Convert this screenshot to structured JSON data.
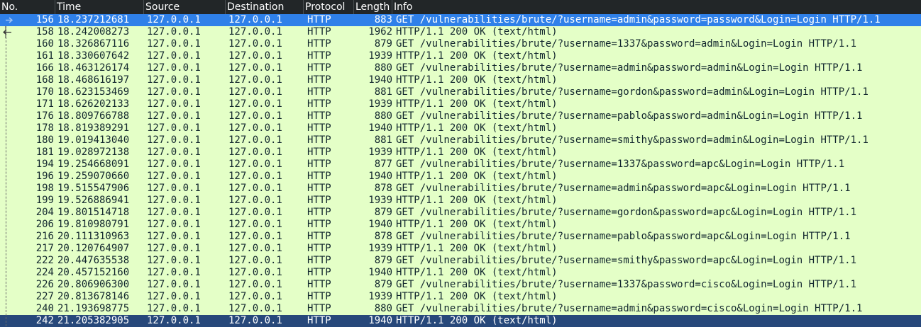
{
  "columns": {
    "no": "No.",
    "time": "Time",
    "source": "Source",
    "destination": "Destination",
    "protocol": "Protocol",
    "length": "Length",
    "info": "Info"
  },
  "colors": {
    "row_bg": "#e4ffc7",
    "header_bg": "#222628",
    "selected_row": "#2f80e9",
    "focused_row": "#27487a",
    "text": "#12272e"
  },
  "icons": {
    "request": "request-arrow-icon",
    "response": "response-arrow-icon"
  },
  "packets": [
    {
      "no": "156",
      "time": "18.237212681",
      "src": "127.0.0.1",
      "dst": "127.0.0.1",
      "proto": "HTTP",
      "len": "883",
      "info": "GET /vulnerabilities/brute/?username=admin&password=password&Login=Login HTTP/1.1"
    },
    {
      "no": "158",
      "time": "18.242008273",
      "src": "127.0.0.1",
      "dst": "127.0.0.1",
      "proto": "HTTP",
      "len": "1962",
      "info": "HTTP/1.1 200 OK  (text/html)"
    },
    {
      "no": "160",
      "time": "18.326867116",
      "src": "127.0.0.1",
      "dst": "127.0.0.1",
      "proto": "HTTP",
      "len": "879",
      "info": "GET /vulnerabilities/brute/?username=1337&password=admin&Login=Login HTTP/1.1"
    },
    {
      "no": "161",
      "time": "18.330607642",
      "src": "127.0.0.1",
      "dst": "127.0.0.1",
      "proto": "HTTP",
      "len": "1939",
      "info": "HTTP/1.1 200 OK  (text/html)"
    },
    {
      "no": "166",
      "time": "18.463126174",
      "src": "127.0.0.1",
      "dst": "127.0.0.1",
      "proto": "HTTP",
      "len": "880",
      "info": "GET /vulnerabilities/brute/?username=admin&password=admin&Login=Login HTTP/1.1"
    },
    {
      "no": "168",
      "time": "18.468616197",
      "src": "127.0.0.1",
      "dst": "127.0.0.1",
      "proto": "HTTP",
      "len": "1940",
      "info": "HTTP/1.1 200 OK  (text/html)"
    },
    {
      "no": "170",
      "time": "18.623153469",
      "src": "127.0.0.1",
      "dst": "127.0.0.1",
      "proto": "HTTP",
      "len": "881",
      "info": "GET /vulnerabilities/brute/?username=gordon&password=admin&Login=Login HTTP/1.1"
    },
    {
      "no": "171",
      "time": "18.626202133",
      "src": "127.0.0.1",
      "dst": "127.0.0.1",
      "proto": "HTTP",
      "len": "1939",
      "info": "HTTP/1.1 200 OK  (text/html)"
    },
    {
      "no": "176",
      "time": "18.809766788",
      "src": "127.0.0.1",
      "dst": "127.0.0.1",
      "proto": "HTTP",
      "len": "880",
      "info": "GET /vulnerabilities/brute/?username=pablo&password=admin&Login=Login HTTP/1.1"
    },
    {
      "no": "178",
      "time": "18.819389291",
      "src": "127.0.0.1",
      "dst": "127.0.0.1",
      "proto": "HTTP",
      "len": "1940",
      "info": "HTTP/1.1 200 OK  (text/html)"
    },
    {
      "no": "180",
      "time": "19.019413040",
      "src": "127.0.0.1",
      "dst": "127.0.0.1",
      "proto": "HTTP",
      "len": "881",
      "info": "GET /vulnerabilities/brute/?username=smithy&password=admin&Login=Login HTTP/1.1"
    },
    {
      "no": "181",
      "time": "19.028972138",
      "src": "127.0.0.1",
      "dst": "127.0.0.1",
      "proto": "HTTP",
      "len": "1939",
      "info": "HTTP/1.1 200 OK  (text/html)"
    },
    {
      "no": "194",
      "time": "19.254668091",
      "src": "127.0.0.1",
      "dst": "127.0.0.1",
      "proto": "HTTP",
      "len": "877",
      "info": "GET /vulnerabilities/brute/?username=1337&password=apc&Login=Login HTTP/1.1"
    },
    {
      "no": "196",
      "time": "19.259070660",
      "src": "127.0.0.1",
      "dst": "127.0.0.1",
      "proto": "HTTP",
      "len": "1940",
      "info": "HTTP/1.1 200 OK  (text/html)"
    },
    {
      "no": "198",
      "time": "19.515547906",
      "src": "127.0.0.1",
      "dst": "127.0.0.1",
      "proto": "HTTP",
      "len": "878",
      "info": "GET /vulnerabilities/brute/?username=admin&password=apc&Login=Login HTTP/1.1"
    },
    {
      "no": "199",
      "time": "19.526886941",
      "src": "127.0.0.1",
      "dst": "127.0.0.1",
      "proto": "HTTP",
      "len": "1939",
      "info": "HTTP/1.1 200 OK  (text/html)"
    },
    {
      "no": "204",
      "time": "19.801514718",
      "src": "127.0.0.1",
      "dst": "127.0.0.1",
      "proto": "HTTP",
      "len": "879",
      "info": "GET /vulnerabilities/brute/?username=gordon&password=apc&Login=Login HTTP/1.1"
    },
    {
      "no": "206",
      "time": "19.810980791",
      "src": "127.0.0.1",
      "dst": "127.0.0.1",
      "proto": "HTTP",
      "len": "1940",
      "info": "HTTP/1.1 200 OK  (text/html)"
    },
    {
      "no": "216",
      "time": "20.111310963",
      "src": "127.0.0.1",
      "dst": "127.0.0.1",
      "proto": "HTTP",
      "len": "878",
      "info": "GET /vulnerabilities/brute/?username=pablo&password=apc&Login=Login HTTP/1.1"
    },
    {
      "no": "217",
      "time": "20.120764907",
      "src": "127.0.0.1",
      "dst": "127.0.0.1",
      "proto": "HTTP",
      "len": "1939",
      "info": "HTTP/1.1 200 OK  (text/html)"
    },
    {
      "no": "222",
      "time": "20.447635538",
      "src": "127.0.0.1",
      "dst": "127.0.0.1",
      "proto": "HTTP",
      "len": "879",
      "info": "GET /vulnerabilities/brute/?username=smithy&password=apc&Login=Login HTTP/1.1"
    },
    {
      "no": "224",
      "time": "20.457152160",
      "src": "127.0.0.1",
      "dst": "127.0.0.1",
      "proto": "HTTP",
      "len": "1940",
      "info": "HTTP/1.1 200 OK  (text/html)"
    },
    {
      "no": "226",
      "time": "20.806906300",
      "src": "127.0.0.1",
      "dst": "127.0.0.1",
      "proto": "HTTP",
      "len": "879",
      "info": "GET /vulnerabilities/brute/?username=1337&password=cisco&Login=Login HTTP/1.1"
    },
    {
      "no": "227",
      "time": "20.813678146",
      "src": "127.0.0.1",
      "dst": "127.0.0.1",
      "proto": "HTTP",
      "len": "1939",
      "info": "HTTP/1.1 200 OK  (text/html)"
    },
    {
      "no": "240",
      "time": "21.193698775",
      "src": "127.0.0.1",
      "dst": "127.0.0.1",
      "proto": "HTTP",
      "len": "880",
      "info": "GET /vulnerabilities/brute/?username=admin&password=cisco&Login=Login HTTP/1.1"
    },
    {
      "no": "242",
      "time": "21.205382905",
      "src": "127.0.0.1",
      "dst": "127.0.0.1",
      "proto": "HTTP",
      "len": "1940",
      "info": "HTTP/1.1 200 OK  (text/html)"
    }
  ]
}
